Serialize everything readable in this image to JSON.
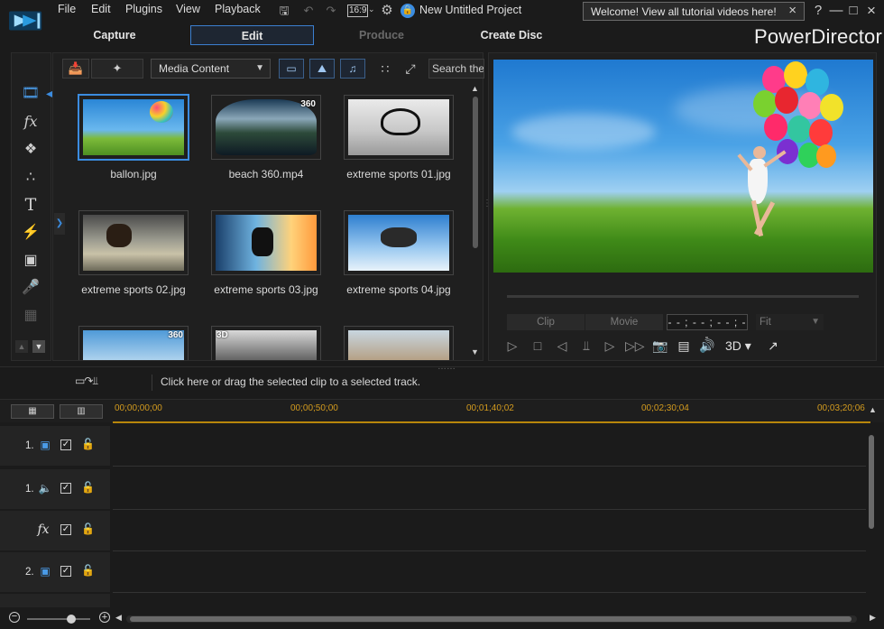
{
  "menu": {
    "items": [
      "File",
      "Edit",
      "Plugins",
      "View",
      "Playback"
    ],
    "project_title": "New Untitled Project",
    "aspect": "16:9",
    "welcome": "Welcome! View all tutorial videos here!"
  },
  "modes": {
    "capture": "Capture",
    "edit": "Edit",
    "produce": "Produce",
    "create_disc": "Create Disc",
    "brand": "PowerDirector"
  },
  "library": {
    "media_select": "Media Content",
    "search_placeholder": "Search the library",
    "items": [
      {
        "label": "ballon.jpg",
        "badge": "",
        "selected": true
      },
      {
        "label": "beach 360.mp4",
        "badge": "360",
        "selected": false
      },
      {
        "label": "extreme sports 01.jpg",
        "badge": "",
        "selected": false
      },
      {
        "label": "extreme sports 02.jpg",
        "badge": "",
        "selected": false
      },
      {
        "label": "extreme sports 03.jpg",
        "badge": "",
        "selected": false
      },
      {
        "label": "extreme sports 04.jpg",
        "badge": "",
        "selected": false
      },
      {
        "label": "",
        "badge": "360",
        "selected": false
      },
      {
        "label": "",
        "badge": "3D",
        "selected": false
      },
      {
        "label": "",
        "badge": "",
        "selected": false
      }
    ]
  },
  "preview": {
    "clip_tab": "Clip",
    "movie_tab": "Movie",
    "timecode": "- - ; - - ; - - ; - -",
    "fit": "Fit",
    "three_d": "3D"
  },
  "strip": {
    "hint": "Click here or drag the selected clip to a selected track."
  },
  "timeline": {
    "ticks": [
      "00;00;00;00",
      "00;00;50;00",
      "00;01;40;02",
      "00;02;30;04",
      "00;03;20;06"
    ],
    "tracks": [
      {
        "num": "1.",
        "type_icon": "video-track-icon"
      },
      {
        "num": "1.",
        "type_icon": "audio-track-icon"
      },
      {
        "num": "",
        "type_icon": "fx-track-icon"
      },
      {
        "num": "2.",
        "type_icon": "video-track-icon"
      }
    ]
  },
  "colors": {
    "accent": "#3b8ce0",
    "timeline_gold": "#d39b1e"
  }
}
